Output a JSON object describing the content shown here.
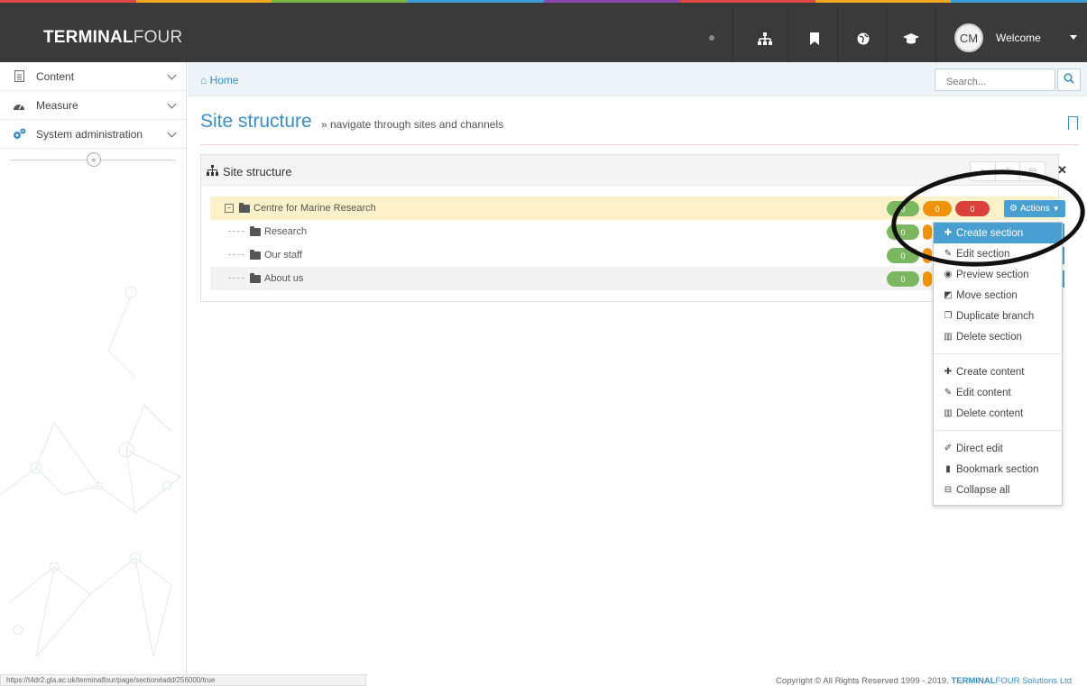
{
  "colors": {
    "topbar": "#3a3a3a",
    "accent_blue": "#3b8ec2",
    "button_blue": "#4a9fd1",
    "pill_green": "#7bb661",
    "pill_orange": "#f0930c",
    "pill_red": "#d9423a",
    "selected_row": "#fcf1c8",
    "strip": [
      "#e04848",
      "#f2a81d",
      "#7cb342",
      "#3e9bd6",
      "#8e44ad",
      "#e04848",
      "#f2a81d",
      "#3e9bd6"
    ]
  },
  "topbar": {
    "logo_bold": "TERMINAL",
    "logo_light": "FOUR",
    "icons": [
      "sitemap-icon",
      "bookmark-icon",
      "globe-icon",
      "graduation-cap-icon"
    ],
    "avatar_initials": "CM",
    "welcome_label": "Welcome"
  },
  "sidebar": {
    "items": [
      {
        "label": "Content",
        "icon": "document-icon"
      },
      {
        "label": "Measure",
        "icon": "dashboard-icon"
      },
      {
        "label": "System administration",
        "icon": "cogs-icon"
      }
    ],
    "collapse_glyph": "«"
  },
  "breadcrumb": {
    "home_label": "Home"
  },
  "search": {
    "placeholder": "Search..."
  },
  "page": {
    "title": "Site structure",
    "subtitle": "» navigate through sites and channels"
  },
  "panel": {
    "title": "Site structure",
    "tree": [
      {
        "label": "Centre for Marine Research",
        "counts": [
          "0",
          "0",
          "0"
        ],
        "selected": true
      },
      {
        "label": "Research",
        "counts": [
          "0"
        ]
      },
      {
        "label": "Our staff",
        "counts": [
          "0"
        ]
      },
      {
        "label": "About us",
        "counts": [
          "0"
        ]
      }
    ],
    "actions_label": "Actions"
  },
  "dropdown": {
    "group1": [
      {
        "label": "Create section",
        "icon": "plus-icon",
        "active": true
      },
      {
        "label": "Edit section",
        "icon": "edit-icon"
      },
      {
        "label": "Preview section",
        "icon": "eye-icon"
      },
      {
        "label": "Move section",
        "icon": "move-icon"
      },
      {
        "label": "Duplicate branch",
        "icon": "duplicate-icon"
      },
      {
        "label": "Delete section",
        "icon": "trash-icon"
      }
    ],
    "group2": [
      {
        "label": "Create content",
        "icon": "plus-icon"
      },
      {
        "label": "Edit content",
        "icon": "edit-icon"
      },
      {
        "label": "Delete content",
        "icon": "trash-icon"
      }
    ],
    "group3": [
      {
        "label": "Direct edit",
        "icon": "pencil-icon"
      },
      {
        "label": "Bookmark section",
        "icon": "bookmark-icon"
      },
      {
        "label": "Collapse all",
        "icon": "collapse-icon"
      }
    ]
  },
  "statusbar": {
    "url": "https://t4dr2.gla.ac.uk/terminalfour/page/section#add/256000/true"
  },
  "footer": {
    "copyright": "Copyright © All Rights Reserved 1999 - 2019.",
    "brand_bold": "TERMINAL",
    "brand_rest": "FOUR Solutions Ltd"
  }
}
